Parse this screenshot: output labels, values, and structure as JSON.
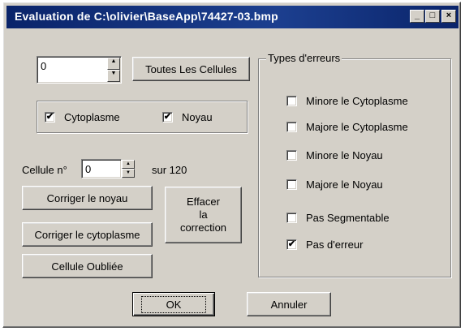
{
  "window": {
    "title": "Evaluation de C:\\olivier\\BaseApp\\74427-03.bmp",
    "minimize_glyph": "_",
    "maximize_glyph": "□",
    "close_glyph": "×"
  },
  "top": {
    "counter_value": "0",
    "all_cells_button": "Toutes Les Cellules"
  },
  "display": {
    "cytoplasme": {
      "label": "Cytoplasme",
      "checked": true
    },
    "noyau": {
      "label": "Noyau",
      "checked": true
    }
  },
  "cell": {
    "label": "Cellule n°",
    "value": "0",
    "total_text": "sur 120"
  },
  "actions": {
    "fix_nucleus": "Corriger le noyau",
    "fix_cytoplasm": "Corriger le cytoplasme",
    "clear_line1": "Effacer",
    "clear_line2": "la",
    "clear_line3": "correction",
    "forgotten_cell": "Cellule Oubliée"
  },
  "errors": {
    "legend": "Types d'erreurs",
    "items": [
      {
        "label": "Minore le Cytoplasme",
        "checked": false
      },
      {
        "label": "Majore le Cytoplasme",
        "checked": false
      },
      {
        "label": "Minore le Noyau",
        "checked": false
      },
      {
        "label": "Majore le Noyau",
        "checked": false
      },
      {
        "label": "Pas Segmentable",
        "checked": false
      },
      {
        "label": "Pas d'erreur",
        "checked": true
      }
    ]
  },
  "footer": {
    "ok": "OK",
    "cancel": "Annuler"
  }
}
